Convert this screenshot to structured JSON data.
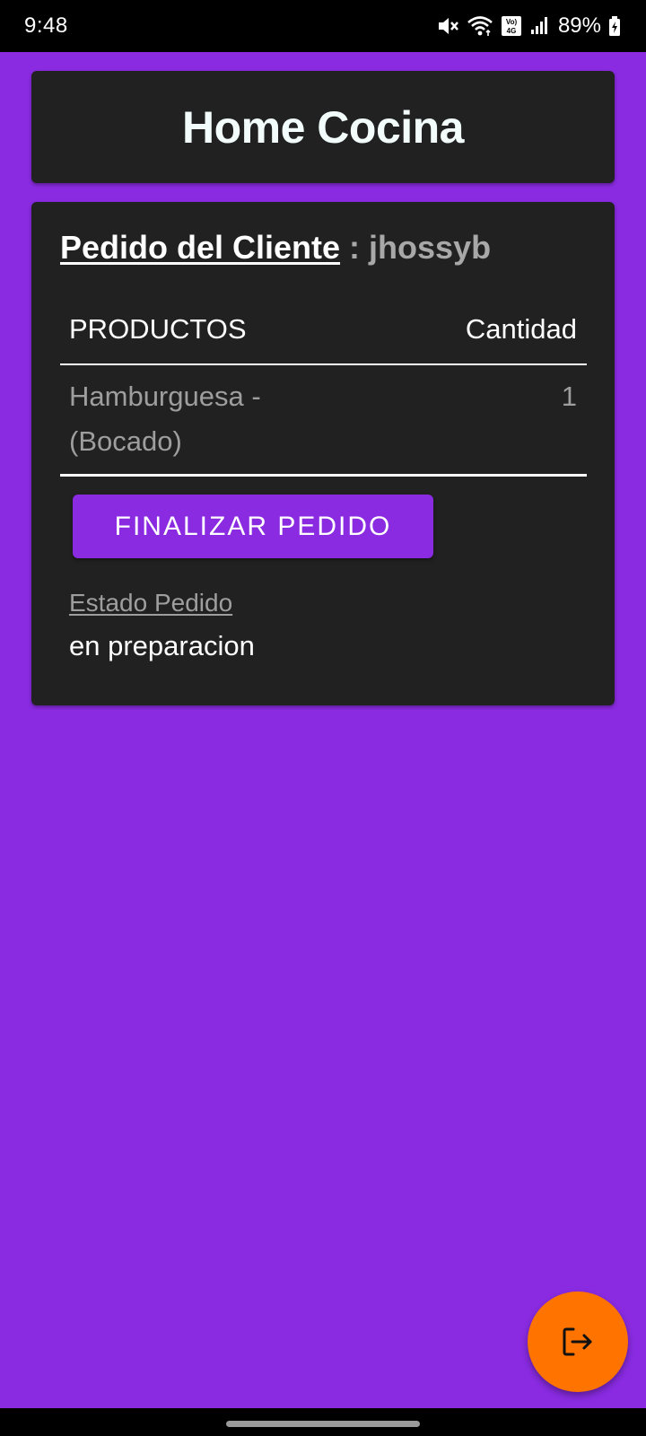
{
  "status_bar": {
    "time": "9:48",
    "volte_label_top": "Vo)",
    "volte_label_bottom": "4G",
    "battery": "89%",
    "icons": [
      "mute-icon",
      "wifi-icon",
      "volte-icon",
      "signal-icon",
      "battery-icon"
    ]
  },
  "header": {
    "title": "Home Cocina"
  },
  "order": {
    "heading_label": "Pedido del Cliente",
    "separator": " : ",
    "client_name": "jhossyb",
    "columns": {
      "products": "PRODUCTOS",
      "quantity": "Cantidad"
    },
    "items": [
      {
        "name": "Hamburguesa - (Bocado)",
        "quantity": "1"
      }
    ],
    "finish_button_label": "FINALIZAR PEDIDO",
    "status_label": "Estado Pedido",
    "status_value": "en preparacion"
  },
  "fab": {
    "icon": "logout-icon"
  },
  "colors": {
    "background": "#8A2BE2",
    "card": "#212121",
    "accent": "#8A2BE2",
    "fab": "#FF7300",
    "title_text": "#F1FCFB",
    "muted_text": "#9E9E9E"
  }
}
